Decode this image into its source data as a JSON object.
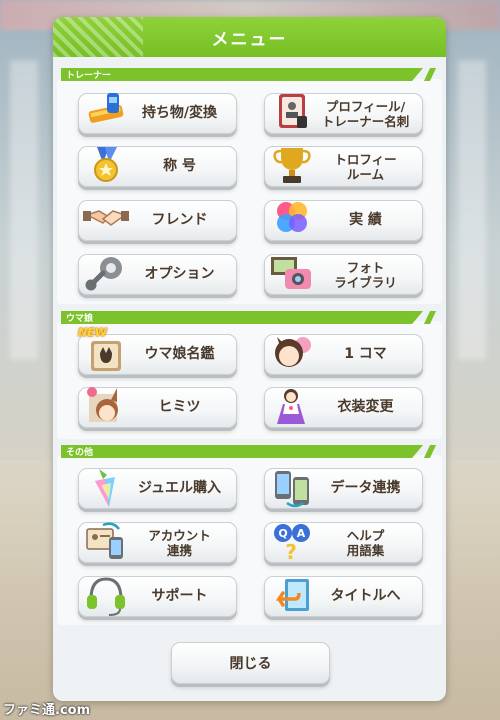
{
  "title": "メニュー",
  "sections": {
    "trainer": "トレーナー",
    "umamusume": "ウマ娘",
    "other": "その他"
  },
  "buttons": {
    "items": "持ち物/変換",
    "profile_line1": "プロフィール/",
    "profile_line2": "トレーナー名刺",
    "title_badge": "称 号",
    "trophy_line1": "トロフィー",
    "trophy_line2": "ルーム",
    "friend": "フレンド",
    "achievement": "実 績",
    "option": "オプション",
    "photo_line1": "フォト",
    "photo_line2": "ライブラリ",
    "uma_dex": "ウマ娘名鑑",
    "koma": "1 コマ",
    "himitsu": "ヒミツ",
    "costume": "衣装変更",
    "jewel": "ジュエル購入",
    "data_link": "データ連携",
    "account_line1": "アカウント",
    "account_line2": "連携",
    "help_line1": "ヘルプ",
    "help_line2": "用語集",
    "support": "サポート",
    "to_title": "タイトルへ"
  },
  "badges": {
    "new": "NEW"
  },
  "close": "閉じる",
  "watermark": "ファミ通.com",
  "colors": {
    "accent": "#7cc22a",
    "button_text": "#4a3a2c",
    "panel": "#eef2f4"
  }
}
